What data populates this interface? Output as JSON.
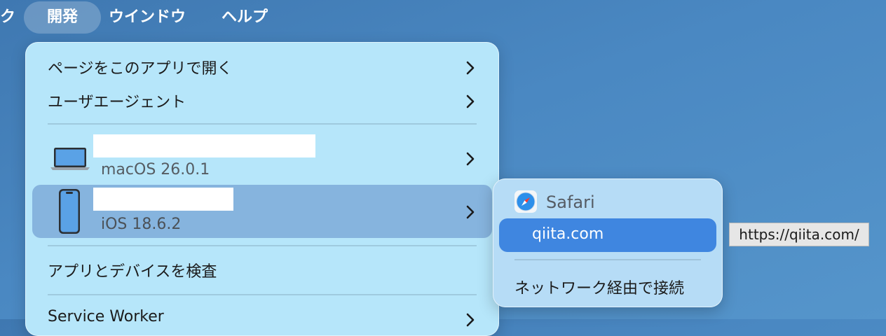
{
  "menubar": {
    "partial_item": "ク",
    "develop": "開発",
    "window": "ウインドウ",
    "help": "ヘルプ"
  },
  "develop_menu": {
    "open_page_with": "ページをこのアプリで開く",
    "user_agent": "ユーザエージェント",
    "devices": [
      {
        "type": "laptop",
        "os": "macOS 26.0.1"
      },
      {
        "type": "phone",
        "os": "iOS 18.6.2"
      }
    ],
    "inspect_apps": "アプリとデバイスを検査",
    "service_worker": "Service Worker"
  },
  "device_submenu": {
    "app_name": "Safari",
    "page_item": "qiita.com",
    "connect_via_network": "ネットワーク経由で接続"
  },
  "tooltip": {
    "url": "https://qiita.com/"
  },
  "colors": {
    "desktop": "#4a88c2",
    "menu_background": "#b6e6fa",
    "highlight_row": "#86b4de",
    "submenu_highlight": "#3f86e0"
  }
}
